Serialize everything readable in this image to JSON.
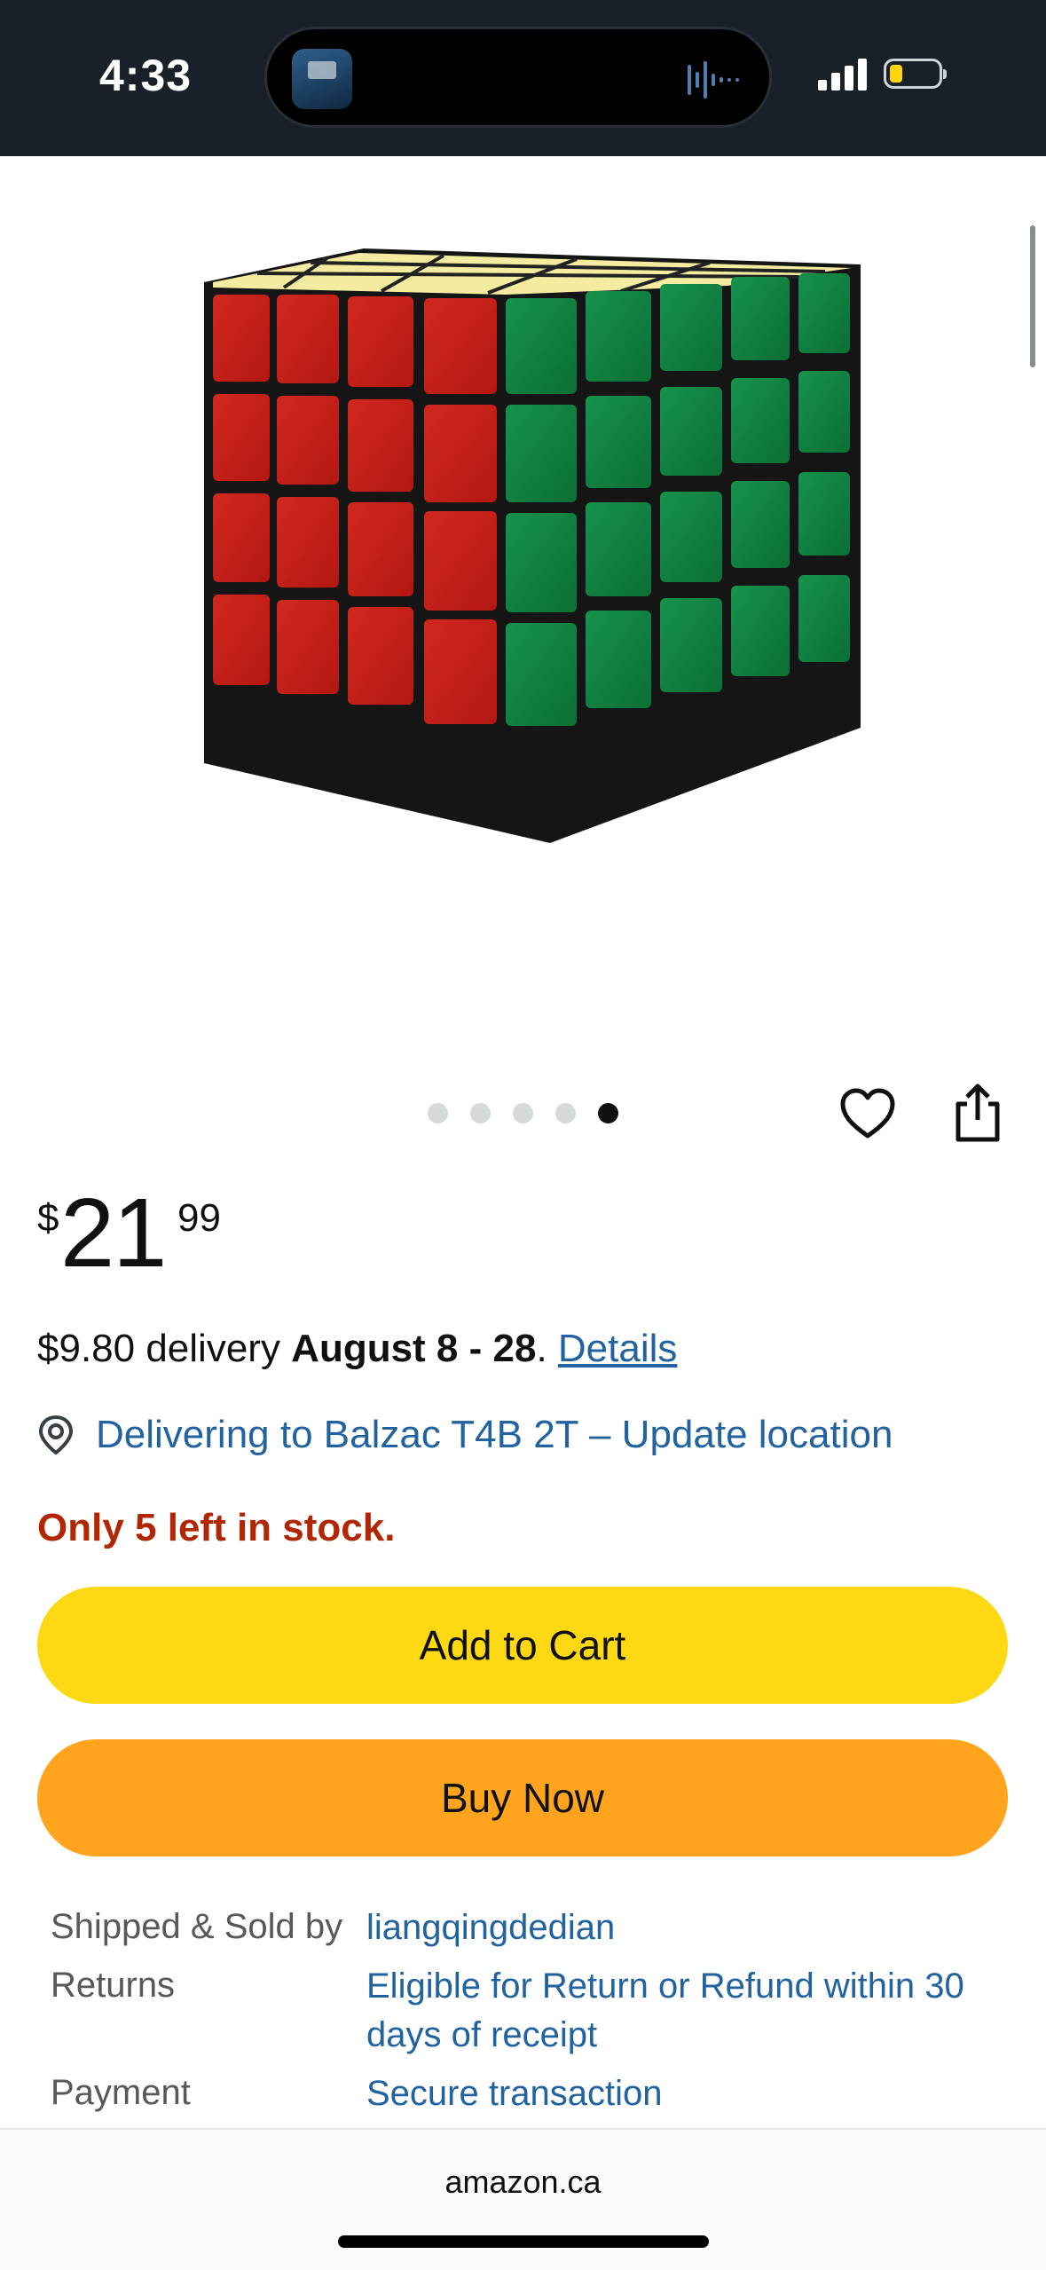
{
  "status_bar": {
    "time": "4:33"
  },
  "carousel": {
    "count": 5,
    "active_index": 4
  },
  "price": {
    "symbol": "$",
    "whole": "21",
    "fraction": "99"
  },
  "delivery": {
    "prefix": "$9.80 delivery ",
    "dates": "August 8 - 28",
    "period": ". ",
    "details_link": "Details"
  },
  "location": {
    "text": "Delivering to Balzac T4B 2T – Update location"
  },
  "stock": {
    "text": "Only 5 left in stock."
  },
  "buttons": {
    "add_to_cart": "Add to Cart",
    "buy_now": "Buy Now"
  },
  "info": {
    "shipped_label": "Shipped & Sold by",
    "shipped_value": "liangqingdedian",
    "returns_label": "Returns",
    "returns_value": "Eligible for Return or Refund within 30 days of receipt",
    "payment_label": "Payment",
    "payment_value": "Secure transaction"
  },
  "browser": {
    "url": "amazon.ca"
  },
  "colors": {
    "accent_link": "#2162a1",
    "stock_red": "#b12704",
    "cart_yellow": "#ffd814",
    "buy_orange": "#ffa41c"
  },
  "icons": {
    "wishlist": "heart-icon",
    "share": "share-icon",
    "location": "location-pin-icon"
  }
}
